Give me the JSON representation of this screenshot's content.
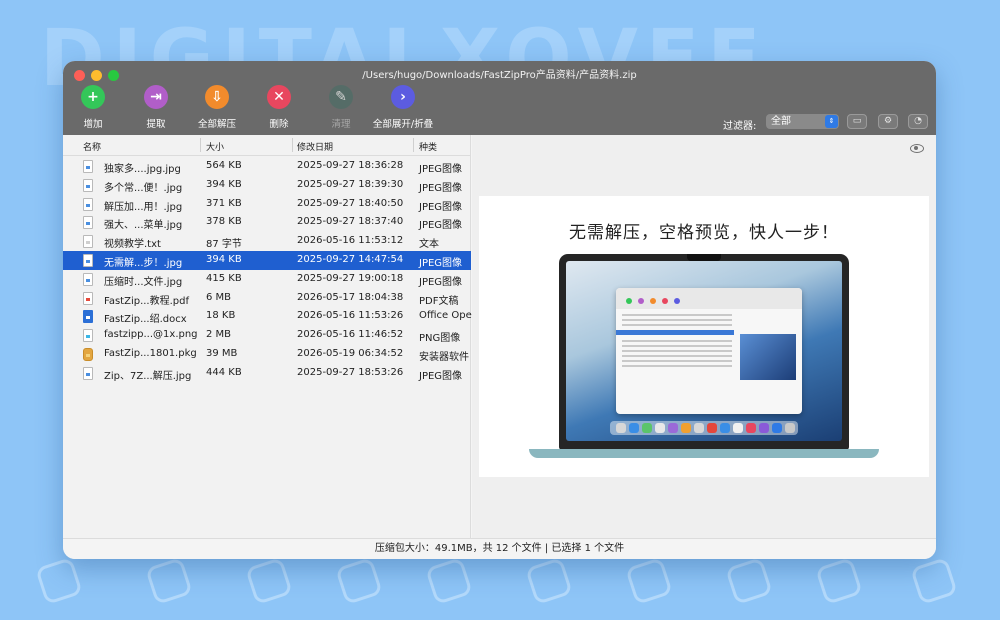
{
  "background": {
    "watermark": "DIGITALXOVEE",
    "color": "#8ec5f7"
  },
  "window": {
    "title": "/Users/hugo/Downloads/FastZipPro产品资料/产品资料.zip"
  },
  "toolbar": {
    "items": [
      {
        "label": "增加",
        "icon": "plus-icon",
        "color": "#34c759",
        "glyph": "+"
      },
      {
        "label": "提取",
        "icon": "extract-icon",
        "color": "#b15ec9",
        "glyph": "⇥"
      },
      {
        "label": "全部解压",
        "icon": "unzip-all-icon",
        "color": "#f28b2c",
        "glyph": "⇩"
      },
      {
        "label": "删除",
        "icon": "delete-icon",
        "color": "#e8475f",
        "glyph": "✕"
      },
      {
        "label": "清理",
        "icon": "clean-icon",
        "color": "#4d6e66",
        "glyph": "✎",
        "disabled": true
      },
      {
        "label": "全部展开/折叠",
        "icon": "expand-collapse-icon",
        "color": "#5c5ce0",
        "glyph": "›"
      }
    ],
    "filter_label": "过滤器:",
    "filter_value": "全部"
  },
  "columns": {
    "name": "名称",
    "size": "大小",
    "date": "修改日期",
    "kind": "种类"
  },
  "files": [
    {
      "name": "独家多....jpg.jpg",
      "size": "564 KB",
      "date": "2025-09-27 18:36:28",
      "kind": "JPEG图像",
      "icon": "jpg"
    },
    {
      "name": "多个常...便！.jpg",
      "size": "394 KB",
      "date": "2025-09-27 18:39:30",
      "kind": "JPEG图像",
      "icon": "jpg"
    },
    {
      "name": "解压加...用！.jpg",
      "size": "371 KB",
      "date": "2025-09-27 18:40:50",
      "kind": "JPEG图像",
      "icon": "jpg"
    },
    {
      "name": "强大、...菜单.jpg",
      "size": "378 KB",
      "date": "2025-09-27 18:37:40",
      "kind": "JPEG图像",
      "icon": "jpg"
    },
    {
      "name": "视频教学.txt",
      "size": "87 字节",
      "date": "2026-05-16 11:53:12",
      "kind": "文本",
      "icon": "txt"
    },
    {
      "name": "无需解...步！.jpg",
      "size": "394 KB",
      "date": "2025-09-27 14:47:54",
      "kind": "JPEG图像",
      "icon": "jpg",
      "selected": true
    },
    {
      "name": "压缩时...文件.jpg",
      "size": "415 KB",
      "date": "2025-09-27 19:00:18",
      "kind": "JPEG图像",
      "icon": "jpg"
    },
    {
      "name": "FastZip...教程.pdf",
      "size": "6 MB",
      "date": "2026-05-17 18:04:38",
      "kind": "PDF文稿",
      "icon": "pdf"
    },
    {
      "name": "FastZip...绍.docx",
      "size": "18 KB",
      "date": "2026-05-16 11:53:26",
      "kind": "Office Ope",
      "icon": "docx"
    },
    {
      "name": "fastzipp...@1x.png",
      "size": "2 MB",
      "date": "2026-05-16 11:46:52",
      "kind": "PNG图像",
      "icon": "png"
    },
    {
      "name": "FastZip...1801.pkg",
      "size": "39 MB",
      "date": "2026-05-19 06:34:52",
      "kind": "安装器软件",
      "icon": "pkg"
    },
    {
      "name": "Zip、7Z...解压.jpg",
      "size": "444 KB",
      "date": "2025-09-27 18:53:26",
      "kind": "JPEG图像",
      "icon": "jpg"
    }
  ],
  "preview": {
    "headline": "无需解压，空格预览，快人一步！"
  },
  "status": {
    "text": "压缩包大小：49.1MB，共 12 个文件   |   已选择 1 个文件"
  },
  "colors": {
    "selection": "#1f5fd0",
    "titlebar": "#6a6a6a"
  }
}
